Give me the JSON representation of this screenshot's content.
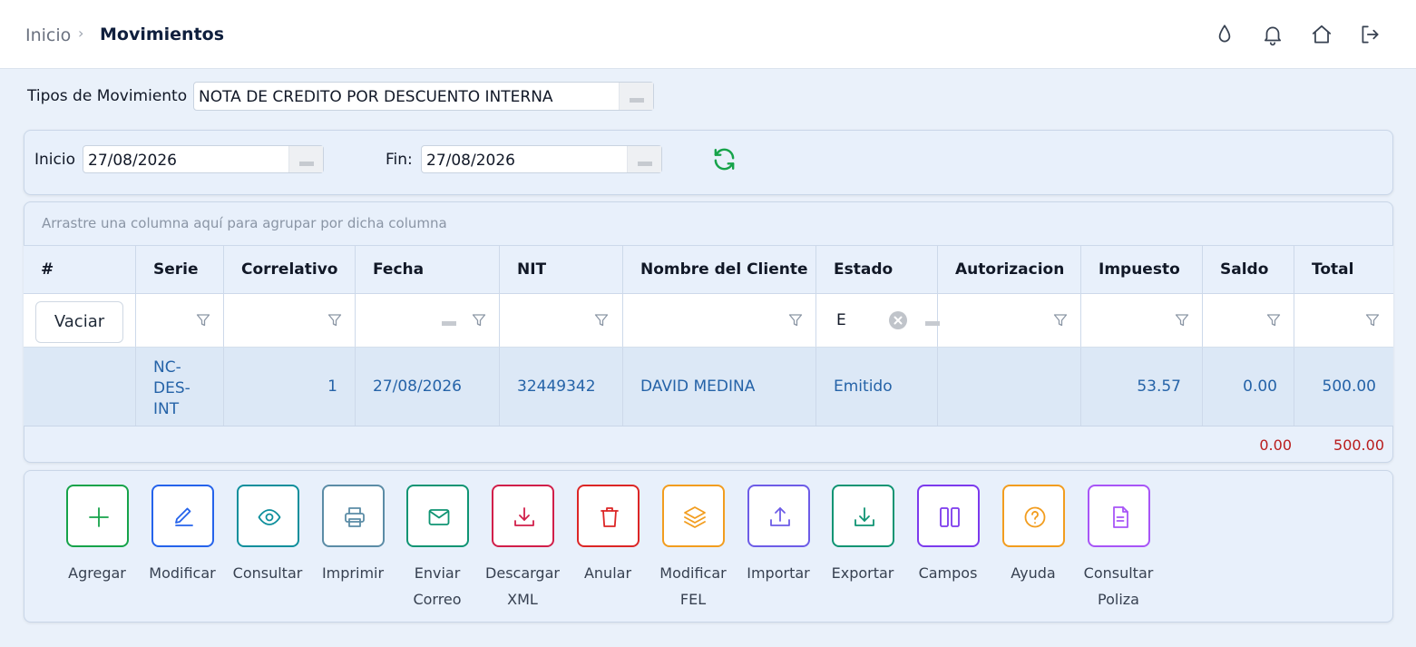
{
  "breadcrumb": {
    "home": "Inicio",
    "separator": "›",
    "current": "Movimientos"
  },
  "top_icons": [
    "drop-icon",
    "bell-icon",
    "home-icon",
    "logout-icon"
  ],
  "tipo": {
    "label": "Tipos de Movimiento",
    "value": "NOTA DE CREDITO POR DESCUENTO INTERNA"
  },
  "dates": {
    "start_label": "Inicio",
    "start_value": "27/08/2026",
    "end_label": "Fin:",
    "end_value": "27/08/2026"
  },
  "grid": {
    "group_hint": "Arrastre una columna aquí para agrupar por dicha columna",
    "columns": [
      "#",
      "Serie",
      "Correlativo",
      "Fecha",
      "NIT",
      "Nombre del Cliente",
      "Estado",
      "Autorizacion",
      "Impuesto",
      "Saldo",
      "Total"
    ],
    "clear_button": "Vaciar",
    "estado_filter": "E",
    "rows": [
      {
        "serie_lines": [
          "NC-",
          "DES-",
          "INT"
        ],
        "correlativo": "1",
        "fecha": "27/08/2026",
        "nit": "32449342",
        "cliente": "DAVID MEDINA",
        "estado": "Emitido",
        "autorizacion": "",
        "impuesto": "53.57",
        "saldo": "0.00",
        "total": "500.00"
      }
    ],
    "summary": {
      "saldo": "0.00",
      "total": "500.00"
    }
  },
  "actions": [
    {
      "label1": "Agregar",
      "label2": "",
      "icon": "plus-icon",
      "color": "#16a34a"
    },
    {
      "label1": "Modificar",
      "label2": "",
      "icon": "edit-icon",
      "color": "#2563eb"
    },
    {
      "label1": "Consultar",
      "label2": "",
      "icon": "eye-icon",
      "color": "#0e8f9c"
    },
    {
      "label1": "Imprimir",
      "label2": "",
      "icon": "printer-icon",
      "color": "#5b8ca6"
    },
    {
      "label1": "Enviar",
      "label2": "Correo",
      "icon": "mail-icon",
      "color": "#0f9473"
    },
    {
      "label1": "Descargar",
      "label2": "XML",
      "icon": "download-icon",
      "color": "#d11f4a"
    },
    {
      "label1": "Anular",
      "label2": "",
      "icon": "trash-icon",
      "color": "#dc2626"
    },
    {
      "label1": "Modificar",
      "label2": "FEL",
      "icon": "layers-icon",
      "color": "#f29d1f"
    },
    {
      "label1": "Importar",
      "label2": "",
      "icon": "upload-icon",
      "color": "#6d5ce7"
    },
    {
      "label1": "Exportar",
      "label2": "",
      "icon": "export-icon",
      "color": "#0f9473"
    },
    {
      "label1": "Campos",
      "label2": "",
      "icon": "columns-icon",
      "color": "#7c3aed"
    },
    {
      "label1": "Ayuda",
      "label2": "",
      "icon": "help-icon",
      "color": "#f29d1f"
    },
    {
      "label1": "Consultar",
      "label2": "Poliza",
      "icon": "document-icon",
      "color": "#a855f7"
    }
  ],
  "colors": {
    "refresh": "#16a34a",
    "data_text": "#2563a8",
    "summary_text": "#b91c1c"
  }
}
